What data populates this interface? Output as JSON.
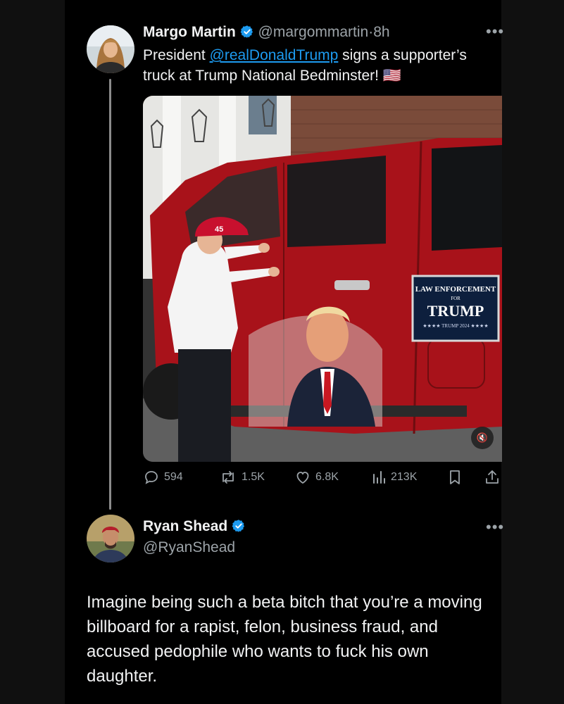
{
  "tweet1": {
    "author_name": "Margo Martin",
    "handle": "@margommartin",
    "separator": "·",
    "time": "8h",
    "text_before": "President ",
    "mention": "@realDonaldTrump",
    "text_after": " signs a supporter’s truck at Trump National Bedminster! ",
    "flag_emoji": "🇺🇸",
    "media": {
      "sign_line1": "LAW ENFORCEMENT",
      "sign_line2": "FOR",
      "sign_line3": "TRUMP",
      "sign_line4": "★★★★ TRUMP 2024 ★★★★",
      "hat_text": "45",
      "mute_icon": "🔇"
    },
    "actions": {
      "replies": "594",
      "reposts": "1.5K",
      "likes": "6.8K",
      "views": "213K"
    }
  },
  "tweet2": {
    "author_name": "Ryan Shead",
    "handle": "@RyanShead",
    "text": "Imagine being such a beta bitch that you’re a moving billboard for a rapist, felon, business fraud, and accused pedophile who wants to fuck his own daughter."
  },
  "colors": {
    "background": "#000000",
    "text": "#e7e9ea",
    "muted": "#9ca3a8",
    "link": "#1d9bf0",
    "verified": "#1d9bf0"
  },
  "icons": [
    "verified-badge-icon",
    "more-icon",
    "reply-icon",
    "repost-icon",
    "like-icon",
    "views-icon",
    "bookmark-icon",
    "share-icon",
    "mute-icon"
  ]
}
